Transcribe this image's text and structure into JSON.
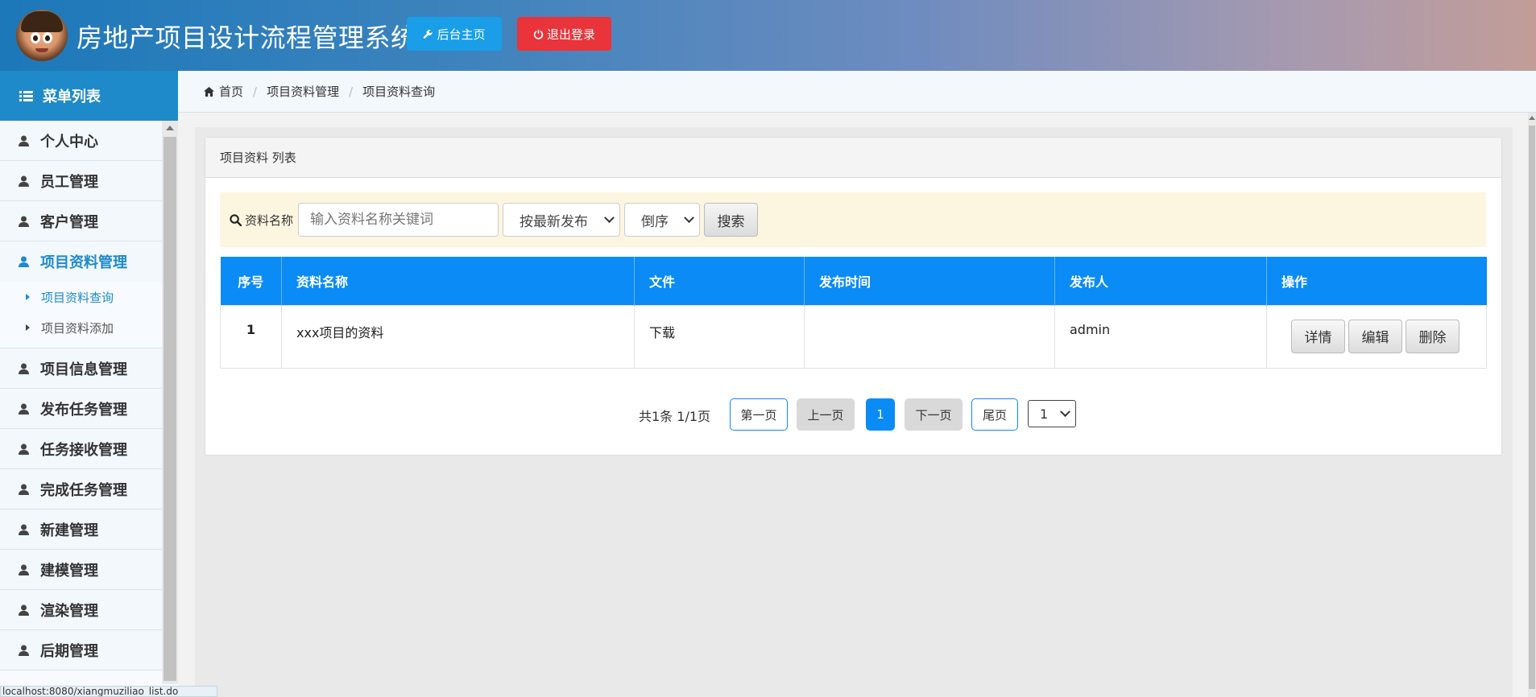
{
  "header": {
    "app_title": "房地产项目设计流程管理系统",
    "home_button": "后台主页",
    "logout_button": "退出登录"
  },
  "sidebar": {
    "title": "菜单列表",
    "items": [
      {
        "label": "个人中心"
      },
      {
        "label": "员工管理"
      },
      {
        "label": "客户管理"
      },
      {
        "label": "项目资料管理",
        "active": true,
        "children": [
          {
            "label": "项目资料查询",
            "active": true
          },
          {
            "label": "项目资料添加"
          }
        ]
      },
      {
        "label": "项目信息管理"
      },
      {
        "label": "发布任务管理"
      },
      {
        "label": "任务接收管理"
      },
      {
        "label": "完成任务管理"
      },
      {
        "label": "新建管理"
      },
      {
        "label": "建模管理"
      },
      {
        "label": "渲染管理"
      },
      {
        "label": "后期管理"
      }
    ]
  },
  "breadcrumb": [
    "首页",
    "项目资料管理",
    "项目资料查询"
  ],
  "panel": {
    "title": "项目资料 列表",
    "search": {
      "label": "资料名称",
      "placeholder": "输入资料名称关键词",
      "sort_selected": "按最新发布",
      "order_selected": "倒序",
      "button": "搜索"
    },
    "table": {
      "columns": [
        "序号",
        "资料名称",
        "文件",
        "发布时间",
        "发布人",
        "操作"
      ],
      "rows": [
        {
          "index": "1",
          "name": "xxx项目的资料",
          "file": "下载",
          "time": "",
          "publisher": "admin",
          "actions": [
            "详情",
            "编辑",
            "删除"
          ]
        }
      ]
    },
    "pager": {
      "summary": "共1条 1/1页",
      "first": "第一页",
      "prev": "上一页",
      "current": "1",
      "next": "下一页",
      "last": "尾页",
      "select": "1"
    }
  },
  "statusbar": {
    "url": "localhost:8080/xiangmuziliao_list.do"
  },
  "colors": {
    "primary": "#0a8bf5",
    "sidebar_head": "#1e8ac9",
    "logout": "#e8343a",
    "home": "#1a9ee8",
    "search_bg": "#fcf6e0"
  }
}
